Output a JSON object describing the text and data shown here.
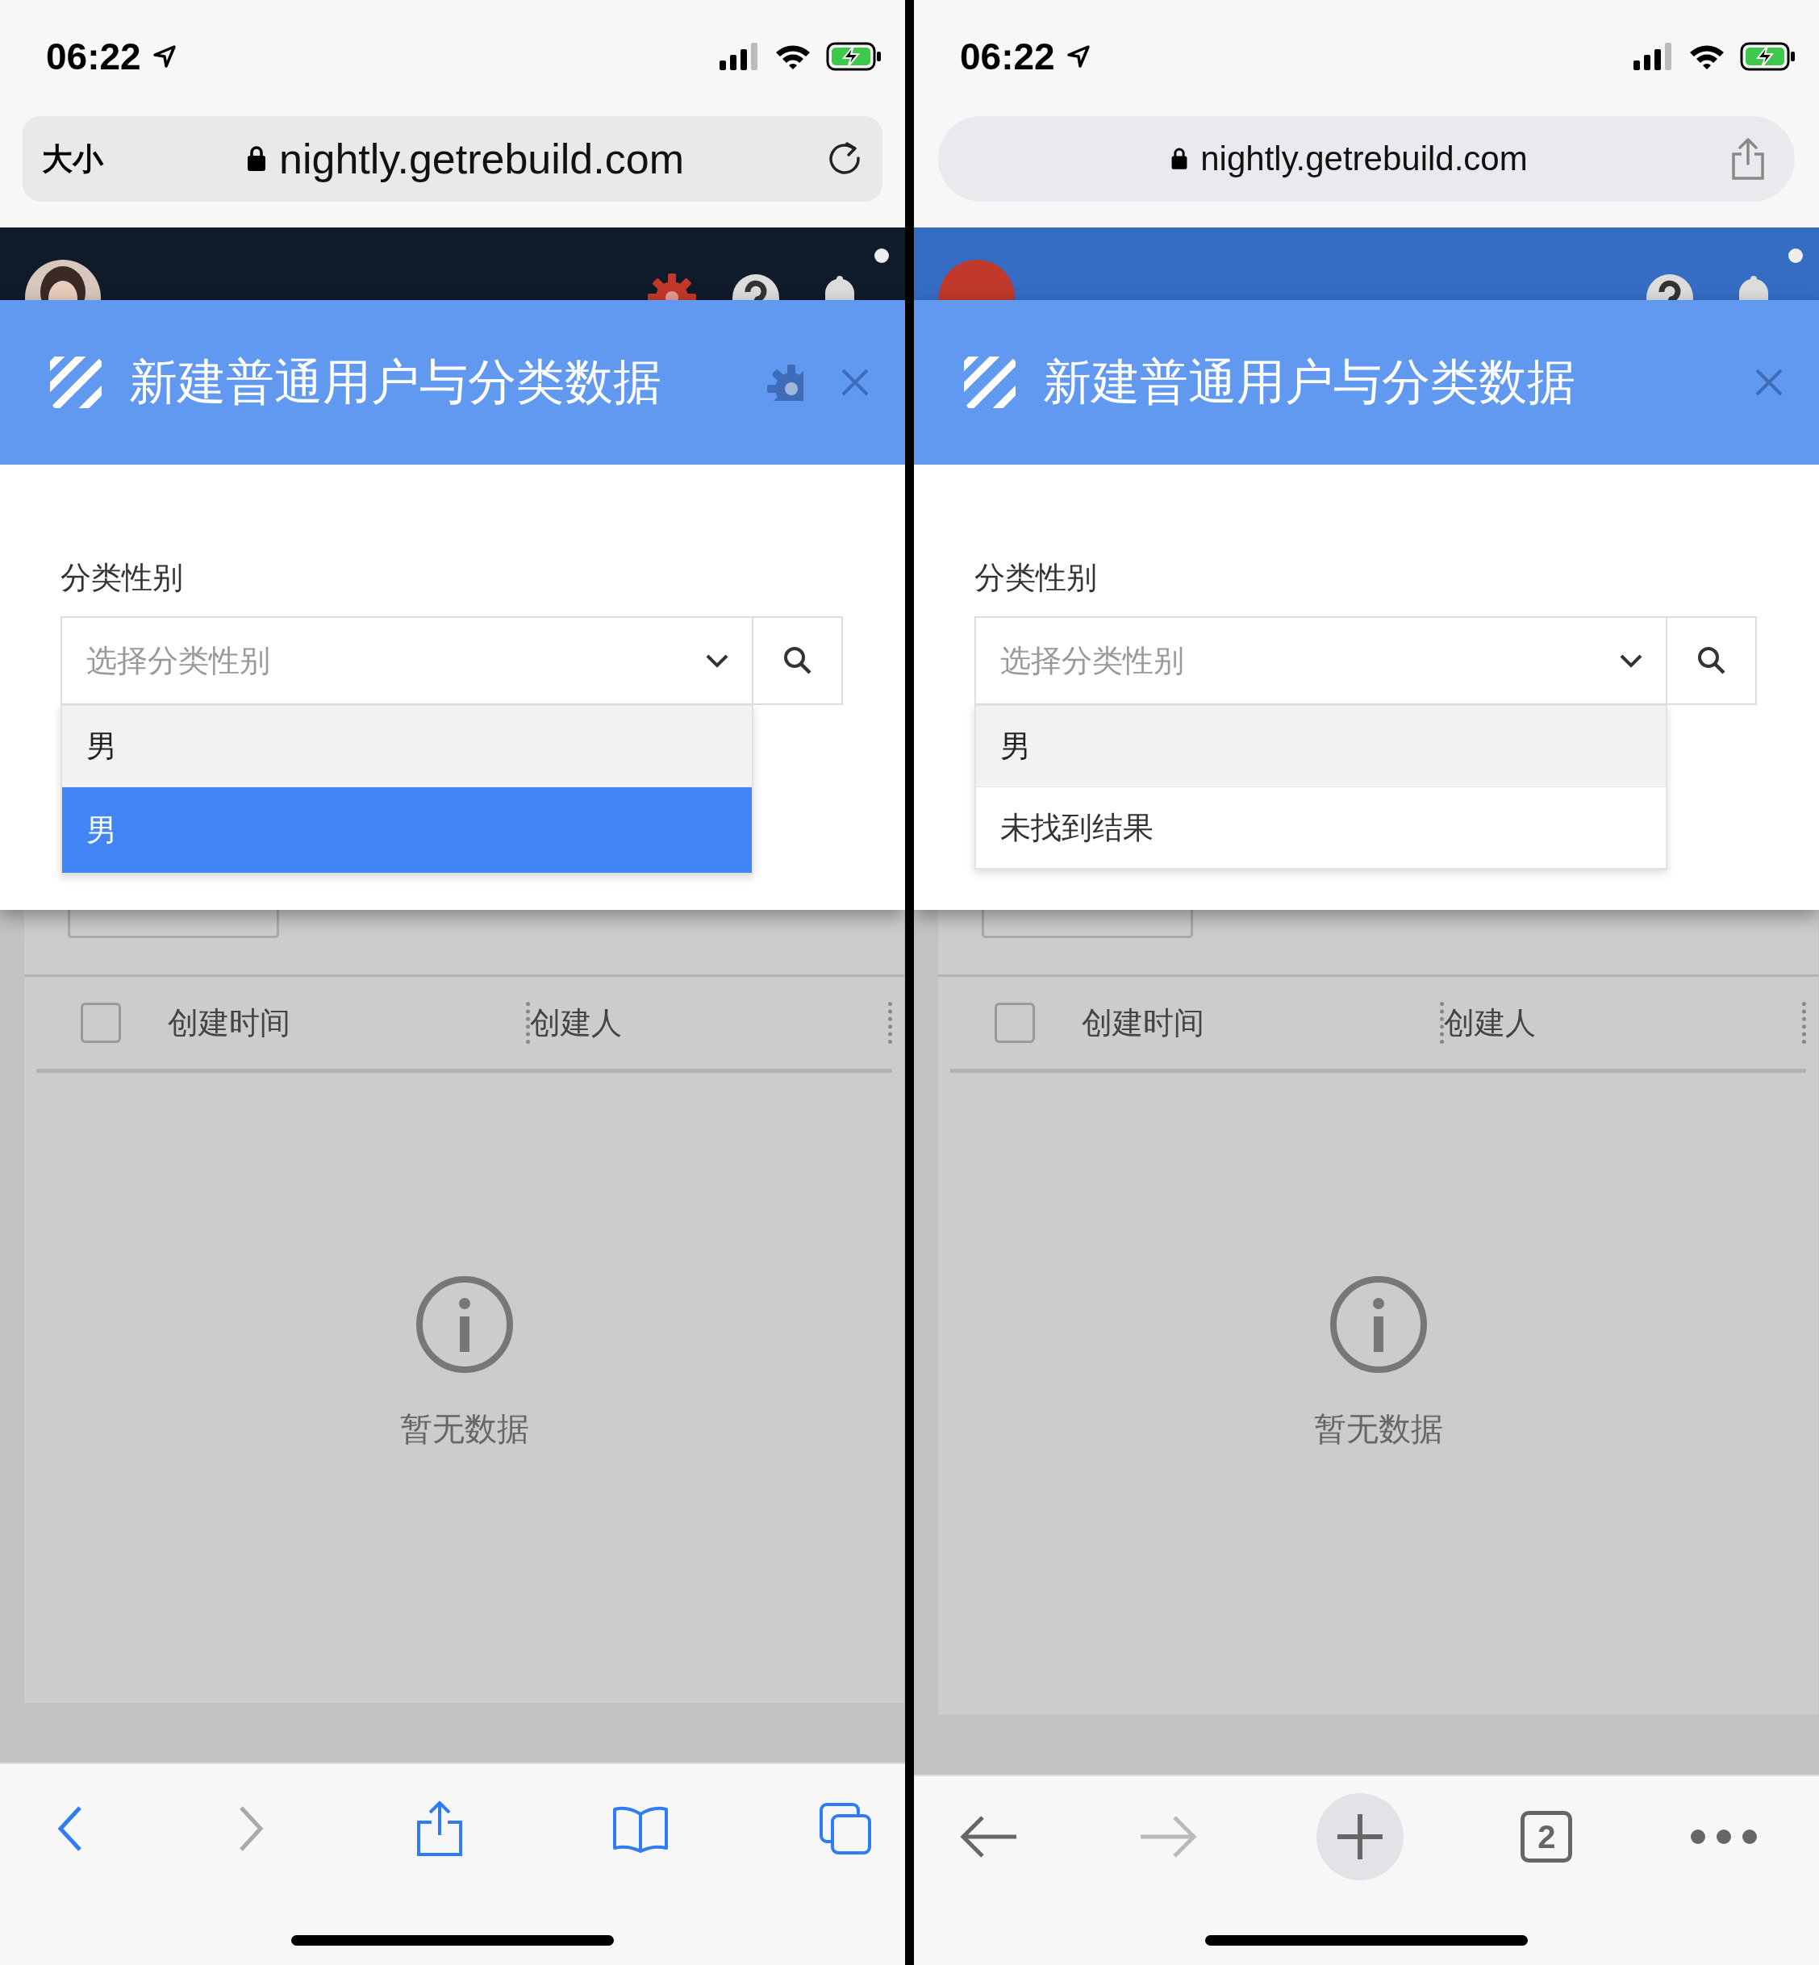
{
  "phones": [
    {
      "status_bar": {
        "time": "06:22"
      },
      "address_bar": {
        "kind": "safari",
        "text_size_button": "大小",
        "url": "nightly.getrebuild.com"
      },
      "app_header": {
        "kind": "dark",
        "settings_icon": true
      },
      "modal": {
        "title": "新建普通用户与分类数据",
        "settings_button": true,
        "field_label": "分类性别",
        "select_placeholder": "选择分类性别",
        "options": [
          {
            "kind": "option",
            "text": "男",
            "highlighted": true,
            "selected": false
          },
          {
            "kind": "option",
            "text": "男",
            "highlighted": false,
            "selected": true
          }
        ]
      },
      "page": {
        "select_all_checked": false,
        "columns": [
          "创建时间",
          "创建人"
        ],
        "empty_text": "暂无数据"
      },
      "toolbar": {
        "kind": "safari"
      }
    },
    {
      "status_bar": {
        "time": "06:22"
      },
      "address_bar": {
        "kind": "chrome",
        "url": "nightly.getrebuild.com"
      },
      "app_header": {
        "kind": "blue",
        "avatar": {
          "kind": "initials"
        },
        "settings_icon": false
      },
      "modal": {
        "title": "新建普通用户与分类数据",
        "settings_button": false,
        "field_label": "分类性别",
        "select_placeholder": "选择分类性别",
        "options": [
          {
            "kind": "option",
            "text": "男",
            "highlighted": true,
            "selected": false
          },
          {
            "kind": "message",
            "text": "未找到结果",
            "highlighted": false,
            "selected": false
          }
        ]
      },
      "page": {
        "select_all_checked": false,
        "columns": [
          "创建时间",
          "创建人"
        ],
        "empty_text": "暂无数据"
      },
      "toolbar": {
        "kind": "chrome",
        "tab_count": "2"
      }
    }
  ]
}
